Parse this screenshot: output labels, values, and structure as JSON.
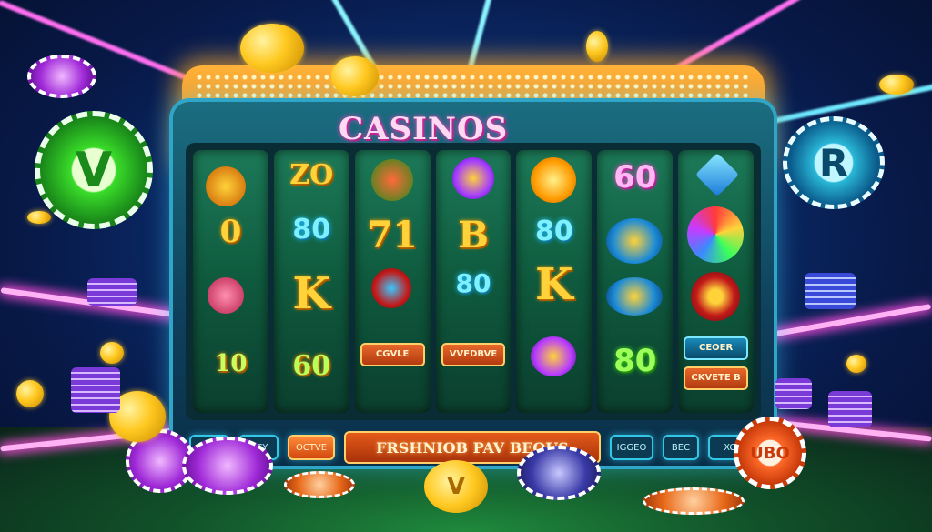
{
  "title": "CASINOS",
  "reels": [
    {
      "symbols": [
        "",
        "0",
        "10"
      ],
      "plaque": ""
    },
    {
      "symbols": [
        "ZO",
        "80",
        "K",
        "60"
      ],
      "plaque": ""
    },
    {
      "symbols": [
        "71",
        "",
        "CGVLE"
      ],
      "plaque": "CGVLE"
    },
    {
      "symbols": [
        "B",
        "80",
        ""
      ],
      "plaque": "VVFDBVE"
    },
    {
      "symbols": [
        "80",
        "K",
        ""
      ],
      "plaque": ""
    },
    {
      "symbols": [
        "60",
        "",
        "80"
      ],
      "plaque": ""
    },
    {
      "symbols": [
        "",
        "",
        ""
      ],
      "plaque": "CEOER"
    }
  ],
  "side_plaque_2": "CKVETE B",
  "controls": {
    "btn1": "LOGO",
    "btn2": "DCY",
    "btn3": "OCTVE",
    "banner": "FRSHNIOB PAV BEOUS",
    "btn4": "IGGEO",
    "btn5": "BEC",
    "btn6": "XCE"
  },
  "chips": {
    "big_green_mark": "V",
    "right_blue_mark": "R",
    "bottom_gold_mark": "V",
    "right_orange_label": "UBO"
  },
  "colors": {
    "marquee": "#f5951f",
    "cabinet": "#1b6d80",
    "neon_pink": "#ff4fe0",
    "neon_cyan": "#3fd8ff",
    "floor": "#1f8a3c"
  }
}
